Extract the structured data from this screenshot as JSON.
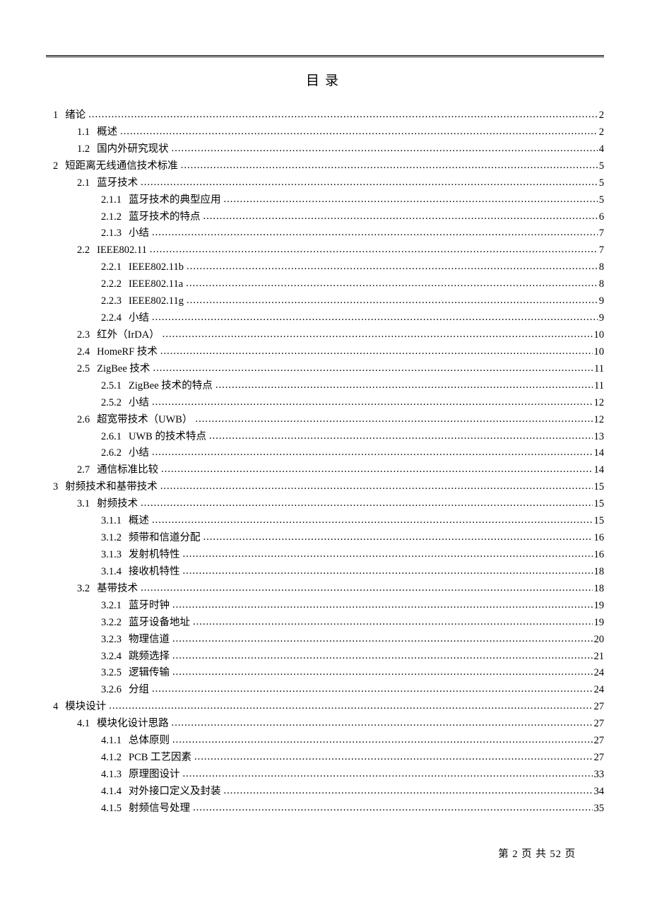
{
  "title": "目录",
  "entries": [
    {
      "level": 1,
      "num": "1",
      "label": "绪论",
      "page": "2"
    },
    {
      "level": 2,
      "num": "1.1",
      "label": "概述",
      "page": "2"
    },
    {
      "level": 2,
      "num": "1.2",
      "label": "国内外研究现状",
      "page": "4"
    },
    {
      "level": 1,
      "num": "2",
      "label": "短距离无线通信技术标准",
      "page": "5"
    },
    {
      "level": 2,
      "num": "2.1",
      "label": "蓝牙技术",
      "page": "5"
    },
    {
      "level": 3,
      "num": "2.1.1",
      "label": "蓝牙技术的典型应用",
      "page": "5"
    },
    {
      "level": 3,
      "num": "2.1.2",
      "label": "蓝牙技术的特点",
      "page": "6"
    },
    {
      "level": 3,
      "num": "2.1.3",
      "label": "小结",
      "page": "7"
    },
    {
      "level": 2,
      "num": "2.2",
      "label": "IEEE802.11",
      "page": "7"
    },
    {
      "level": 3,
      "num": "2.2.1",
      "label": "IEEE802.11b",
      "page": "8"
    },
    {
      "level": 3,
      "num": "2.2.2",
      "label": "IEEE802.11a",
      "page": "8"
    },
    {
      "level": 3,
      "num": "2.2.3",
      "label": "IEEE802.11g",
      "page": "9"
    },
    {
      "level": 3,
      "num": "2.2.4",
      "label": "小结",
      "page": "9"
    },
    {
      "level": 2,
      "num": "2.3",
      "label": "红外（IrDA）",
      "page": "10"
    },
    {
      "level": 2,
      "num": "2.4",
      "label": "HomeRF 技术",
      "page": "10"
    },
    {
      "level": 2,
      "num": "2.5",
      "label": "ZigBee 技术",
      "page": "11"
    },
    {
      "level": 3,
      "num": "2.5.1",
      "label": "ZigBee 技术的特点",
      "page": "11"
    },
    {
      "level": 3,
      "num": "2.5.2",
      "label": "小结",
      "page": "12"
    },
    {
      "level": 2,
      "num": "2.6",
      "label": "超宽带技术（UWB）",
      "page": "12"
    },
    {
      "level": 3,
      "num": "2.6.1",
      "label": "UWB 的技术特点",
      "page": "13"
    },
    {
      "level": 3,
      "num": "2.6.2",
      "label": "小结",
      "page": "14"
    },
    {
      "level": 2,
      "num": "2.7",
      "label": "通信标准比较",
      "page": "14"
    },
    {
      "level": 1,
      "num": "3",
      "label": "射频技术和基带技术",
      "page": "15"
    },
    {
      "level": 2,
      "num": "3.1",
      "label": "射频技术",
      "page": "15"
    },
    {
      "level": 3,
      "num": "3.1.1",
      "label": "概述",
      "page": "15"
    },
    {
      "level": 3,
      "num": "3.1.2",
      "label": "频带和信道分配",
      "page": "16"
    },
    {
      "level": 3,
      "num": "3.1.3",
      "label": "发射机特性",
      "page": "16"
    },
    {
      "level": 3,
      "num": "3.1.4",
      "label": "接收机特性",
      "page": "18"
    },
    {
      "level": 2,
      "num": "3.2",
      "label": "基带技术",
      "page": "18"
    },
    {
      "level": 3,
      "num": "3.2.1",
      "label": "蓝牙时钟",
      "page": "19"
    },
    {
      "level": 3,
      "num": "3.2.2",
      "label": "蓝牙设备地址",
      "page": "19"
    },
    {
      "level": 3,
      "num": "3.2.3",
      "label": "物理信道",
      "page": "20"
    },
    {
      "level": 3,
      "num": "3.2.4",
      "label": "跳频选择",
      "page": "21"
    },
    {
      "level": 3,
      "num": "3.2.5",
      "label": "逻辑传输",
      "page": "24"
    },
    {
      "level": 3,
      "num": "3.2.6",
      "label": "分组",
      "page": "24"
    },
    {
      "level": 1,
      "num": "4",
      "label": "模块设计",
      "page": "27"
    },
    {
      "level": 2,
      "num": "4.1",
      "label": "模块化设计思路",
      "page": "27"
    },
    {
      "level": 3,
      "num": "4.1.1",
      "label": "总体原则",
      "page": "27"
    },
    {
      "level": 3,
      "num": "4.1.2",
      "label": "PCB 工艺因素",
      "page": "27"
    },
    {
      "level": 3,
      "num": "4.1.3",
      "label": "原理图设计",
      "page": "33"
    },
    {
      "level": 3,
      "num": "4.1.4",
      "label": "对外接口定义及封装",
      "page": "34"
    },
    {
      "level": 3,
      "num": "4.1.5",
      "label": "射频信号处理",
      "page": "35"
    }
  ],
  "footer": "第 2 页 共 52 页"
}
